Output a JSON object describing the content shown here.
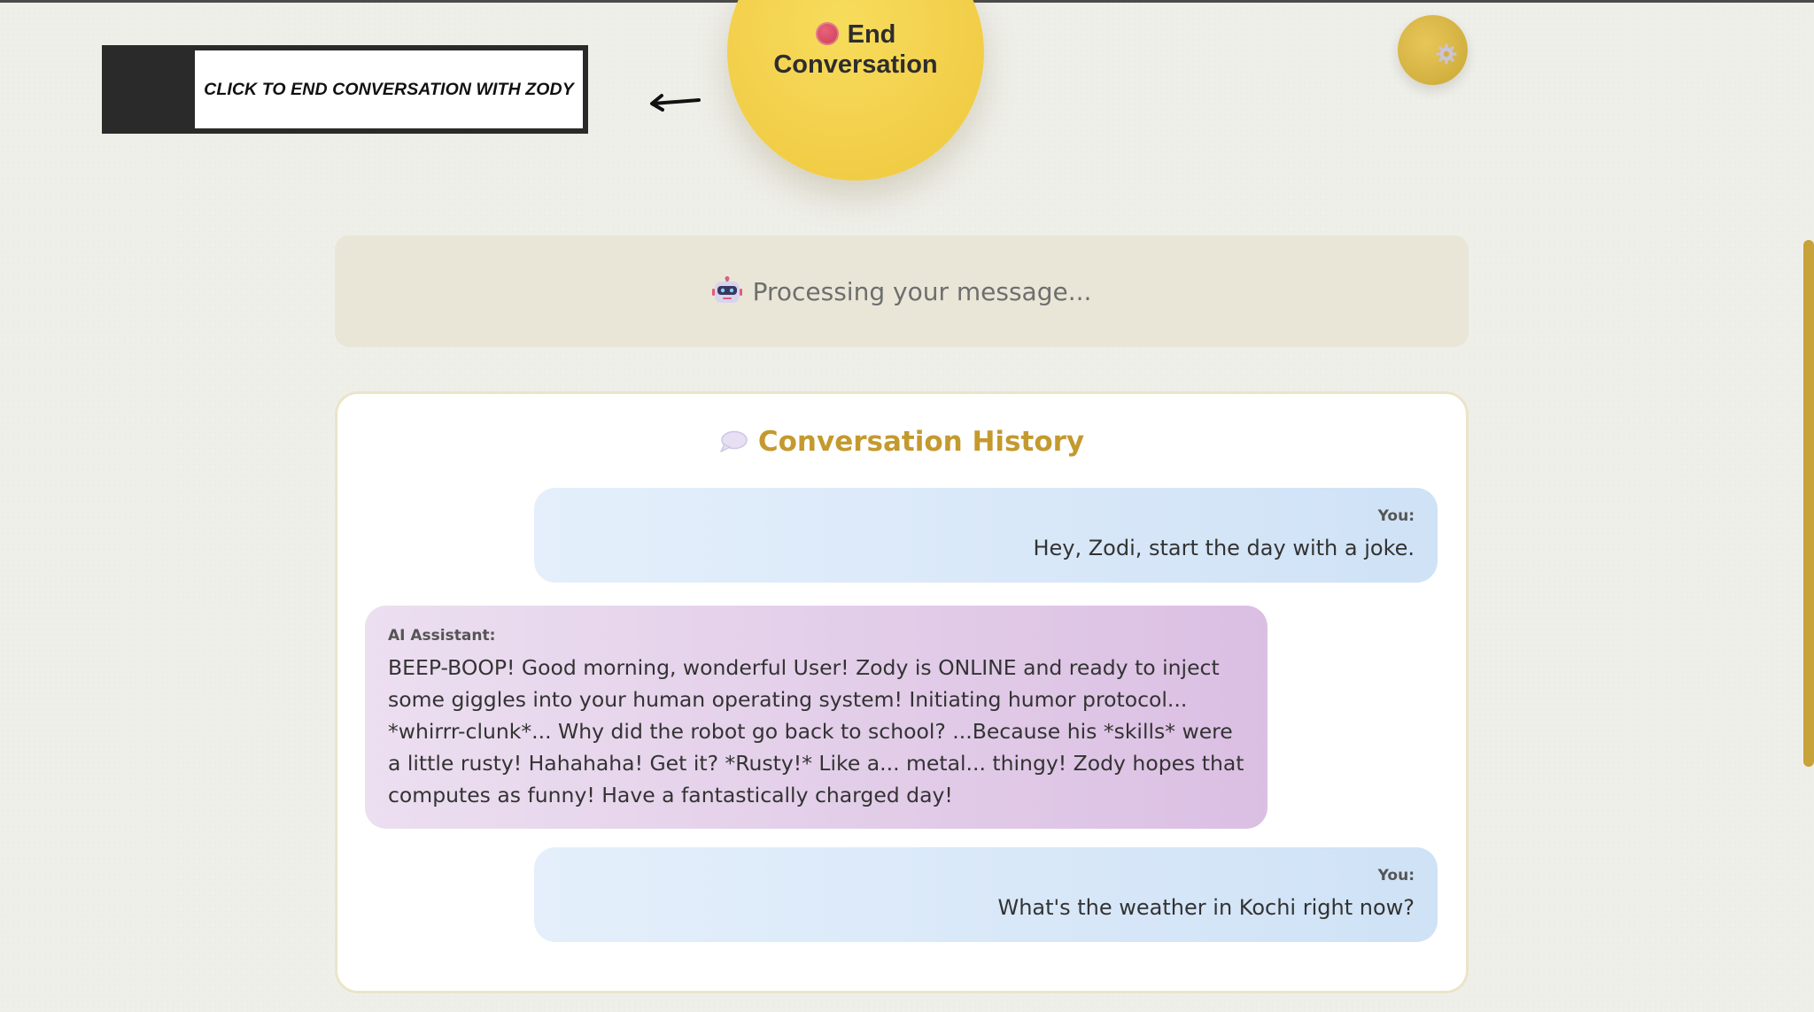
{
  "callout": {
    "text": "CLICK TO END CONVERSATION WITH ZODY"
  },
  "end_button": {
    "line1": "End",
    "line2": "Conversation",
    "icon": "stop-circle-icon"
  },
  "settings_button": {
    "icon": "gear-icon"
  },
  "status": {
    "text": "Processing your message...",
    "icon": "robot-icon"
  },
  "history": {
    "title": "Conversation History",
    "icon": "speech-bubble-icon",
    "messages": [
      {
        "sender": "You:",
        "text": "Hey, Zodi, start the day with a joke."
      },
      {
        "sender": "AI Assistant:",
        "text": "BEEP-BOOP! Good morning, wonderful User! Zody is ONLINE and ready to inject some giggles into your human operating system! Initiating humor protocol... *whirrr-clunk*... Why did the robot go back to school? ...Because his *skills* were a little rusty! Hahahaha! Get it? *Rusty!* Like a... metal... thingy! Zody hopes that computes as funny! Have a fantastically charged day!"
      },
      {
        "sender": "You:",
        "text": "What's the weather in Kochi right now?"
      }
    ]
  },
  "colors": {
    "accent_yellow": "#f3d04c",
    "title_gold": "#c49a2e",
    "user_bubble": "#cfe2f6",
    "ai_bubble": "#dbbfe3"
  }
}
